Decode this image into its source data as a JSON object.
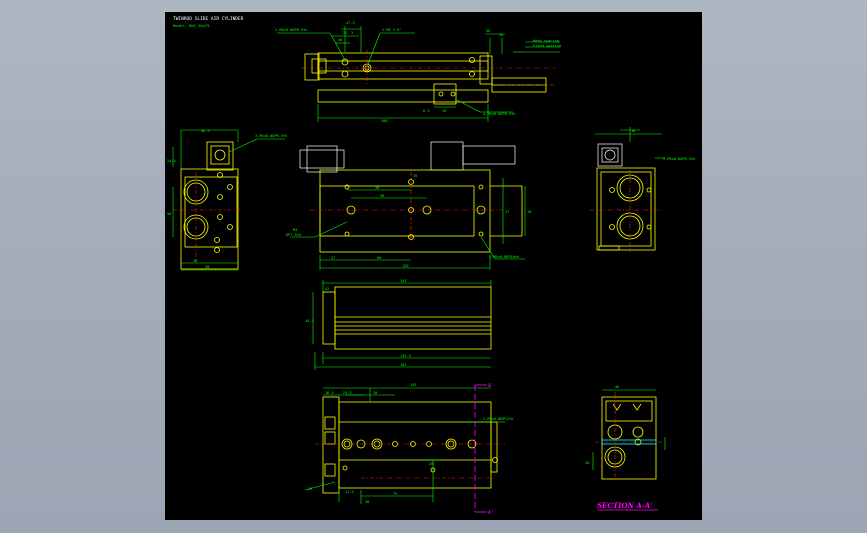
{
  "title_block": {
    "title": "TWINROD SLIDE AIR CYLINDER",
    "model": "Model: MXS 20x75"
  },
  "section_label": "SECTION A-A'",
  "section_markers": {
    "a": "A",
    "a_prime": "A'"
  },
  "callouts": {
    "top_left": "2-M4x0.6DP6.5th",
    "top_center": "2-M5 Y.6\"",
    "top_right_1": "Head spacing",
    "top_right_2": "Fixed spacing",
    "top_bottom": "4-M4x0.6DP6.5th",
    "left_view": "3-M4x0.6DP6.5th",
    "front_left_1": "M4",
    "front_left_2": "DP7.5th",
    "front_bottom": "2-M5x0.8DP10th",
    "right_view": "2-M5x0.8DP6.5th",
    "bottom_right": "2-M5x0.8DP12th"
  },
  "dimensions": {
    "top": [
      "47.5",
      "22",
      "40",
      "3",
      "40",
      "12",
      "6.3",
      "20",
      "108"
    ],
    "left": [
      "46.5",
      "24.4",
      "50",
      "18",
      "30"
    ],
    "front": [
      "50",
      "30",
      "18",
      "27",
      "60",
      "120",
      "37",
      "35"
    ],
    "right": [
      "10"
    ],
    "side": [
      "147",
      "42",
      "44.3",
      "145.5",
      "181"
    ],
    "bottom": [
      "16.5",
      "23.5",
      "30",
      "145",
      "75",
      "20",
      "11.5",
      "39",
      "28"
    ],
    "section": [
      "46",
      "20"
    ]
  },
  "colors": {
    "background": "#000000",
    "outline": "#ffff00",
    "dimension": "#00ff00",
    "hidden": "#ffffff",
    "centerline": "#ff2020",
    "section": "#ff00ff",
    "highlight": "#00ffff",
    "viewport_bg": "#a4acb9"
  }
}
